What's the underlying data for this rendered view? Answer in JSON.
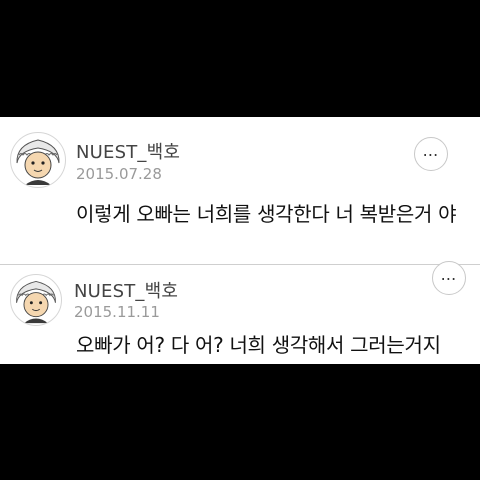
{
  "posts": [
    {
      "username": "NUEST_백호",
      "date": "2015.07.28",
      "text": "이렇게 오빠는 너희를 생각한다 너 복받은거 야",
      "more_icon": "⋯"
    },
    {
      "username": "NUEST_백호",
      "date": "2015.11.11",
      "text": "오빠가 어? 다 어? 너희 생각해서 그러는거지",
      "more_icon": "⋯"
    }
  ]
}
